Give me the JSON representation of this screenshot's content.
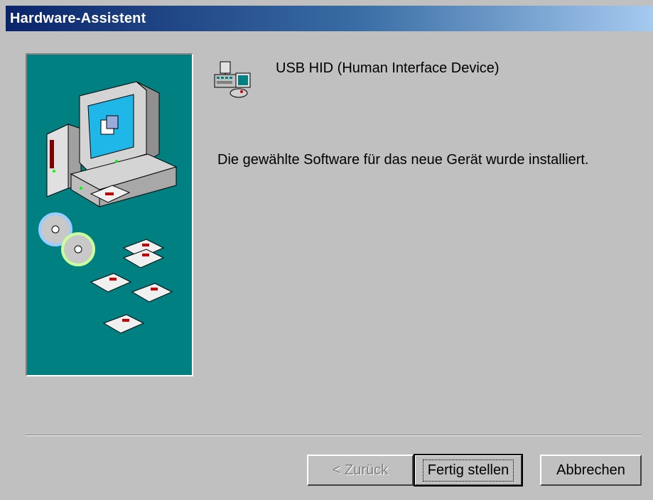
{
  "window": {
    "title": "Hardware-Assistent"
  },
  "device": {
    "name": "USB HID (Human Interface Device)",
    "icon": "keyboard-mouse-device-icon"
  },
  "message": "Die gewählte Software für das neue Gerät wurde installiert.",
  "buttons": {
    "back": "< Zurück",
    "finish": "Fertig stellen",
    "cancel": "Abbrechen"
  },
  "colors": {
    "title_bar_start": "#0a246a",
    "title_bar_end": "#a6caf0",
    "illustration_bg": "#008080",
    "dialog_bg": "#c0c0c0"
  }
}
